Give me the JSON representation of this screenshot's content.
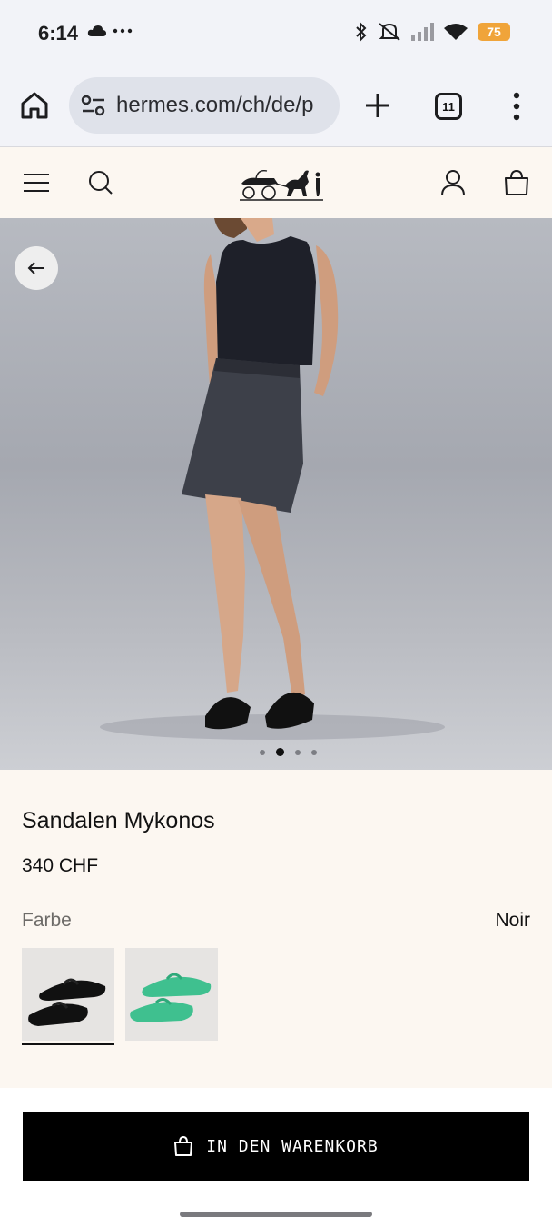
{
  "status_bar": {
    "time": "6:14",
    "battery": "75",
    "icons": [
      "cloud-icon",
      "more-dots-icon",
      "bluetooth-icon",
      "mute-icon",
      "signal-icon",
      "wifi-icon"
    ]
  },
  "browser": {
    "url": "hermes.com/ch/de/p",
    "tab_count": "11"
  },
  "site_header": {
    "icons": [
      "menu-icon",
      "search-icon",
      "hermes-logo",
      "account-icon",
      "bag-icon"
    ]
  },
  "gallery": {
    "slide_count": 4,
    "active_slide": 2
  },
  "product": {
    "name": "Sandalen Mykonos",
    "price": "340 CHF",
    "color_label": "Farbe",
    "selected_color": "Noir",
    "swatches": [
      {
        "name": "Noir",
        "color": "#111111"
      },
      {
        "name": "Vert",
        "color": "#3fc08f"
      }
    ]
  },
  "cart": {
    "label": "IN DEN WARENKORB"
  },
  "colors": {
    "accent_black": "#000000",
    "cream_background": "#fcf7f1",
    "battery": "#f0a43a"
  }
}
